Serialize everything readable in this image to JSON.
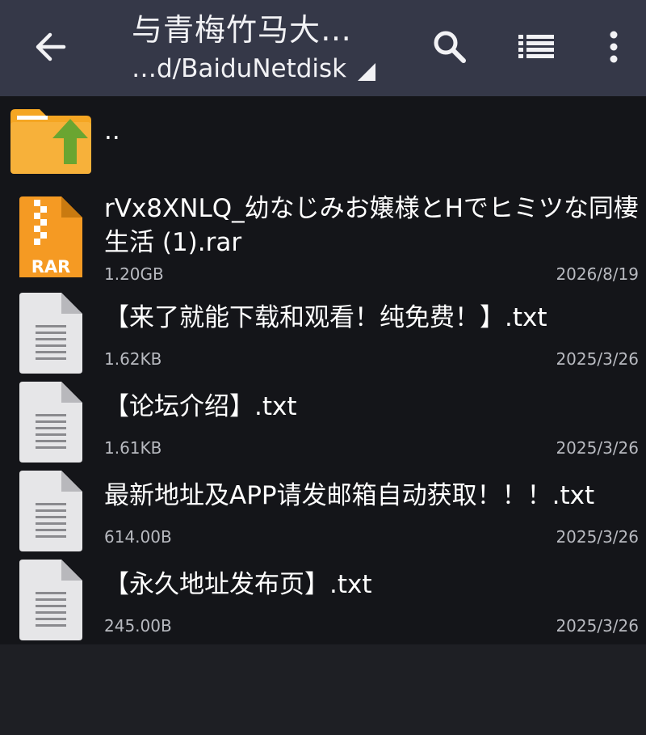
{
  "toolbar": {
    "title": "与青梅竹马大…",
    "path": "…d/BaiduNetdisk"
  },
  "files": [
    {
      "name": "..",
      "type": "parent"
    },
    {
      "name": "rVx8XNLQ_幼なじみお嬢様とHでヒミツな同棲生活 (1).rar",
      "type": "rar",
      "size": "1.20GB",
      "date": "2026/8/19",
      "icon_label": "RAR"
    },
    {
      "name": "【来了就能下载和观看！纯免费！】.txt",
      "type": "txt",
      "size": "1.62KB",
      "date": "2025/3/26"
    },
    {
      "name": "【论坛介绍】.txt",
      "type": "txt",
      "size": "1.61KB",
      "date": "2025/3/26"
    },
    {
      "name": "最新地址及APP请发邮箱自动获取！！！.txt",
      "type": "txt",
      "size": "614.00B",
      "date": "2025/3/26"
    },
    {
      "name": "【永久地址发布页】.txt",
      "type": "txt",
      "size": "245.00B",
      "date": "2025/3/26"
    }
  ],
  "colors": {
    "toolbar_bg": "#353848",
    "list_bg": "#141519",
    "folder": "#f5a623",
    "up_arrow": "#6aa531",
    "rar": "#f59a23"
  }
}
